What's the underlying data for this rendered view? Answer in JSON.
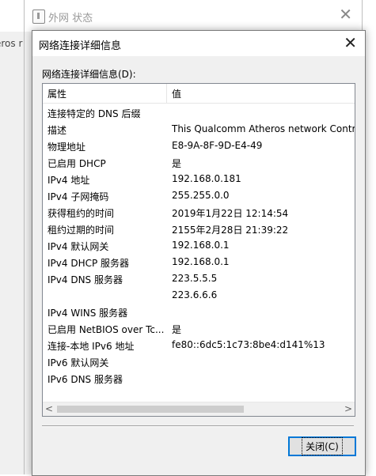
{
  "background": {
    "left_text": "eros r"
  },
  "back_window": {
    "title": "外网 状态",
    "close_glyph": "✕"
  },
  "dialog": {
    "title": "网络连接详细信息",
    "close_glyph": "✕",
    "section_label": "网络连接详细信息(D):",
    "columns": {
      "property": "属性",
      "value": "值"
    },
    "rows": [
      {
        "key": "连接特定的 DNS 后缀",
        "value": ""
      },
      {
        "key": "描述",
        "value": "This Qualcomm Atheros network Contro"
      },
      {
        "key": "物理地址",
        "value": "E8-9A-8F-9D-E4-49"
      },
      {
        "key": "已启用 DHCP",
        "value": "是"
      },
      {
        "key": "IPv4 地址",
        "value": "192.168.0.181"
      },
      {
        "key": "IPv4 子网掩码",
        "value": "255.255.0.0"
      },
      {
        "key": "获得租约的时间",
        "value": "2019年1月22日 12:14:54"
      },
      {
        "key": "租约过期的时间",
        "value": "2155年2月28日 21:39:22"
      },
      {
        "key": "IPv4 默认网关",
        "value": "192.168.0.1"
      },
      {
        "key": "IPv4 DHCP 服务器",
        "value": "192.168.0.1"
      },
      {
        "key": "IPv4 DNS 服务器",
        "value": "223.5.5.5"
      },
      {
        "key": "",
        "value": "223.6.6.6"
      },
      {
        "key": "IPv4 WINS 服务器",
        "value": ""
      },
      {
        "key": "已启用 NetBIOS over Tc...",
        "value": "是"
      },
      {
        "key": "连接-本地 IPv6 地址",
        "value": "fe80::6dc5:1c73:8be4:d141%13"
      },
      {
        "key": "IPv6 默认网关",
        "value": ""
      },
      {
        "key": "IPv6 DNS 服务器",
        "value": ""
      }
    ],
    "scroll_left_glyph": "<",
    "scroll_right_glyph": ">",
    "close_button_label": "关闭(C)"
  },
  "colors": {
    "accent": "#0078d7",
    "window_bg": "#f0f0f0"
  },
  "icons": [
    "network-status-icon",
    "close-icon",
    "scroll-left-arrow-icon",
    "scroll-right-arrow-icon"
  ]
}
